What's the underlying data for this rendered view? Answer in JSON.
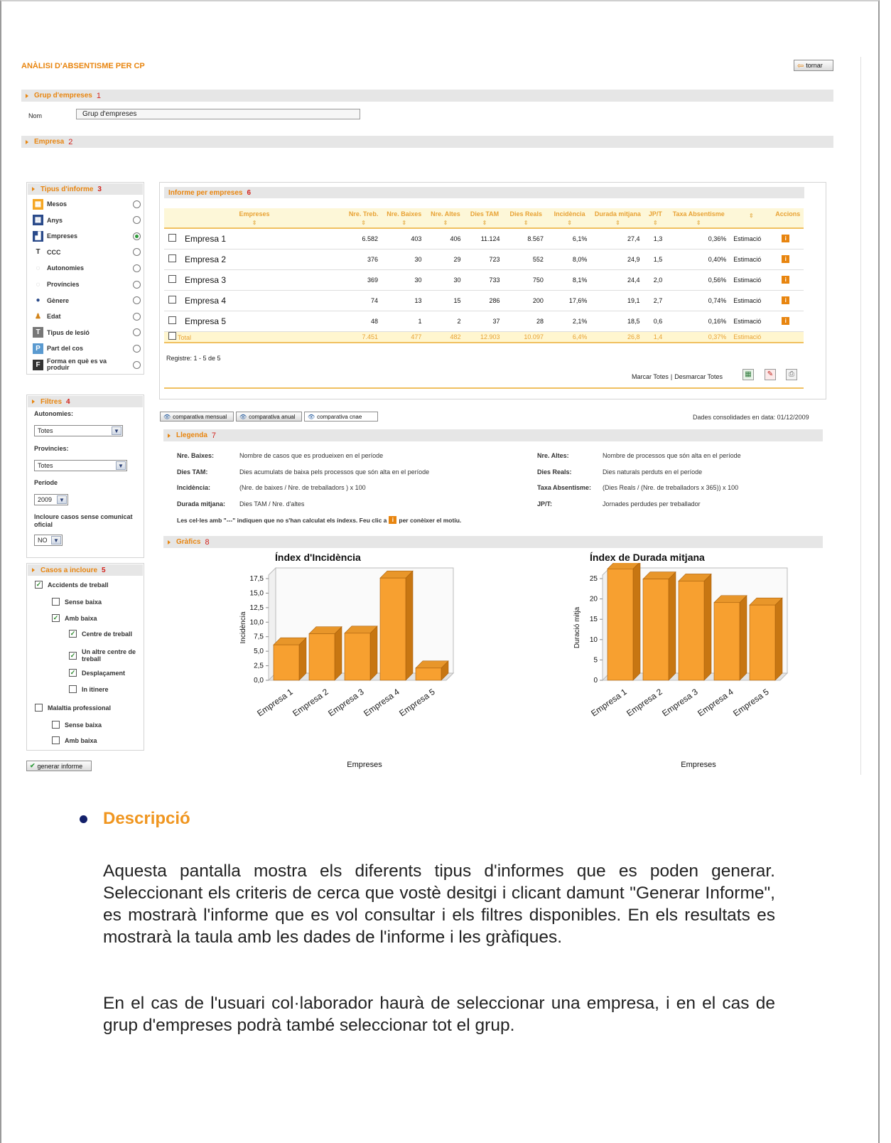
{
  "app": {
    "title": "ANÀLISI D'ABSENTISME PER CP",
    "back_button": "tornar"
  },
  "grup_section": {
    "label": "Grup d'empreses",
    "num": "1",
    "field_label": "Nom",
    "field_value": "Grup d'empreses"
  },
  "empresa_section": {
    "label": "Empresa",
    "num": "2"
  },
  "tipus": {
    "label": "Tipus d'informe",
    "num": "3",
    "items": [
      {
        "label": "Mesos",
        "icon": "calendar-icon",
        "selected": false
      },
      {
        "label": "Anys",
        "icon": "calendar-grid-icon",
        "selected": false
      },
      {
        "label": "Empreses",
        "icon": "factory-icon",
        "selected": true
      },
      {
        "label": "CCC",
        "icon": "ccc-icon",
        "selected": false
      },
      {
        "label": "Autonomies",
        "icon": "map-icon",
        "selected": false
      },
      {
        "label": "Províncies",
        "icon": "province-map-icon",
        "selected": false
      },
      {
        "label": "Gènere",
        "icon": "gender-icon",
        "selected": false
      },
      {
        "label": "Edat",
        "icon": "age-icon",
        "selected": false
      },
      {
        "label": "Tipus de lesió",
        "icon": "t-icon",
        "selected": false
      },
      {
        "label": "Part del cos",
        "icon": "p-icon",
        "selected": false
      },
      {
        "label": "Forma en què es va produir",
        "icon": "f-icon",
        "selected": false
      }
    ]
  },
  "filtres": {
    "label": "Filtres",
    "num": "4",
    "autonomies_label": "Autonomies:",
    "autonomies_value": "Totes",
    "provincies_label": "Provincies:",
    "provincies_value": "Totes",
    "periode_label": "Període",
    "periode_value": "2009",
    "incloure_label": "Incloure casos sense comunicat oficial",
    "incloure_value": "NO"
  },
  "casos": {
    "label": "Casos a incloure",
    "num": "5",
    "accidents": "Accidents de treball",
    "sense_baixa": "Sense baixa",
    "amb_baixa": "Amb baixa",
    "centre": "Centre de treball",
    "altre_centre": "Un altre centre de treball",
    "desplacament": "Desplaçament",
    "in_itinere": "In itinere",
    "malaltia": "Malaltia professional",
    "mal_sense": "Sense baixa",
    "mal_amb": "Amb baixa"
  },
  "generar_button": "generar informe",
  "informe": {
    "label": "Informe per empreses",
    "num": "6",
    "headers": [
      "Empreses",
      "Nre. Treb.",
      "Nre. Baixes",
      "Nre. Altes",
      "Dies TAM",
      "Dies Reals",
      "Incidència",
      "Durada mitjana",
      "JP/T",
      "Taxa Absentisme",
      "",
      "Accions"
    ],
    "rows": [
      [
        "Empresa 1",
        "6.582",
        "403",
        "406",
        "11.124",
        "8.567",
        "6,1%",
        "27,4",
        "1,3",
        "0,36%",
        "Estimació"
      ],
      [
        "Empresa 2",
        "376",
        "30",
        "29",
        "723",
        "552",
        "8,0%",
        "24,9",
        "1,5",
        "0,40%",
        "Estimació"
      ],
      [
        "Empresa 3",
        "369",
        "30",
        "30",
        "733",
        "750",
        "8,1%",
        "24,4",
        "2,0",
        "0,56%",
        "Estimació"
      ],
      [
        "Empresa 4",
        "74",
        "13",
        "15",
        "286",
        "200",
        "17,6%",
        "19,1",
        "2,7",
        "0,74%",
        "Estimació"
      ],
      [
        "Empresa 5",
        "48",
        "1",
        "2",
        "37",
        "28",
        "2,1%",
        "18,5",
        "0,6",
        "0,16%",
        "Estimació"
      ]
    ],
    "total": [
      "Total",
      "7.451",
      "477",
      "482",
      "12.903",
      "10.097",
      "6,4%",
      "26,8",
      "1,4",
      "0,37%",
      "Estimació"
    ],
    "registre": "Registre: 1 - 5 de 5",
    "marcar": "Marcar Totes",
    "sep": "|",
    "desmarcar": "Desmarcar Totes"
  },
  "compare": {
    "mensual": "comparativa mensual",
    "anual": "comparativa anual",
    "cnae": "comparativa cnae"
  },
  "dades": "Dades consolidades en data: 01/12/2009",
  "llegenda": {
    "label": "Llegenda",
    "num": "7",
    "left": [
      {
        "k": "Nre. Baixes:",
        "v": "Nombre de casos que es produeixen en el període"
      },
      {
        "k": "Dies TAM:",
        "v": "Dies acumulats de baixa pels processos que són alta en el període"
      },
      {
        "k": "Incidència:",
        "v": "(Nre. de baixes / Nre. de treballadors ) x 100"
      },
      {
        "k": "Durada mitjana:",
        "v": "Dies TAM / Nre. d'altes"
      }
    ],
    "right": [
      {
        "k": "Nre. Altes:",
        "v": "Nombre de processos que són alta en el període"
      },
      {
        "k": "Dies Reals:",
        "v": "Dies naturals perduts en el període"
      },
      {
        "k": "Taxa Absentisme:",
        "v": "(Dies Reals / (Nre. de treballadors x 365)) x 100"
      },
      {
        "k": "JP/T:",
        "v": "Jornades perdudes per treballador"
      }
    ],
    "note_a": "Les cel·les amb \"---\" indiquen que no s'han calculat els índexs. Feu clic a",
    "note_b": "per conèixer el motiu."
  },
  "grafics": {
    "label": "Gràfics",
    "num": "8"
  },
  "chart_data": [
    {
      "type": "bar",
      "title": "Índex d'Incidència",
      "xlabel": "Empreses",
      "ylabel": "Incidència",
      "categories": [
        "Empresa 1",
        "Empresa 2",
        "Empresa 3",
        "Empresa 4",
        "Empresa 5"
      ],
      "values": [
        6.1,
        8.0,
        8.1,
        17.6,
        2.1
      ],
      "yticks": [
        "0,0",
        "2,5",
        "5,0",
        "7,5",
        "10,0",
        "12,5",
        "15,0",
        "17,5"
      ],
      "ylim": [
        0,
        17.5
      ],
      "color": "#f7a030"
    },
    {
      "type": "bar",
      "title": "Índex de Durada mitjana",
      "xlabel": "Empreses",
      "ylabel": "Duració mitja",
      "categories": [
        "Empresa 1",
        "Empresa 2",
        "Empresa 3",
        "Empresa 4",
        "Empresa 5"
      ],
      "values": [
        27.4,
        24.9,
        24.4,
        19.1,
        18.5
      ],
      "yticks": [
        "0",
        "5",
        "10",
        "15",
        "20",
        "25"
      ],
      "ylim": [
        0,
        25
      ],
      "color": "#f7a030"
    }
  ],
  "description": {
    "heading": "Descripció",
    "p1": "Aquesta pantalla mostra els diferents tipus d'informes que es poden generar. Seleccionant els criteris de cerca que vostè desitgi i clicant damunt \"Generar Informe\", es mostrarà l'informe que es vol consultar i els filtres disponibles. En els resultats es mostrarà la taula amb les dades de l'informe i les gràfiques.",
    "p2": "En el cas de l'usuari col·laborador haurà de seleccionar una empresa, i en el cas de grup d'empreses podrà també seleccionar tot el grup."
  }
}
